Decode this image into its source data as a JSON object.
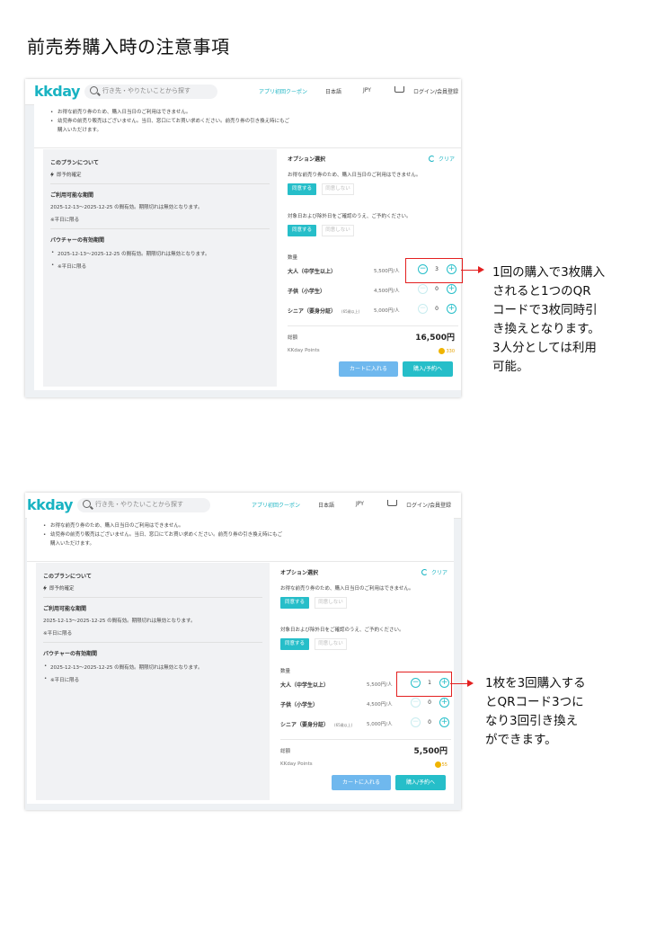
{
  "document": {
    "title": "前売券購入時の注意事項"
  },
  "site": {
    "logo": "kkday",
    "search_placeholder": "行き先・やりたいことから探す",
    "nav_coupon": "アプリ初回クーポン",
    "nav_language": "日本語",
    "nav_currency": "JPY",
    "nav_login": "ログイン/会員登録"
  },
  "notes": {
    "line1": "お得な前売り券のため、購入日当日のご利用はできません。",
    "line2": "幼児券の前売り販売はございません。当日、窓口にてお買い求めください。前売り券の引き換え時にもご",
    "line3": "購入いただけます。"
  },
  "plan": {
    "about_title": "このプランについて",
    "instant": "即予約確定",
    "validity_title": "ご利用可能な期間",
    "validity_text": "2025-12-13〜2025-12-25 の間有効。期限切れは無効となります。",
    "validity_note": "※平日に限る",
    "voucher_title": "バウチャーの有効期間",
    "voucher_bullet1": "2025-12-13〜2025-12-25 の間有効。期限切れは無効となります。",
    "voucher_bullet2": "※平日に限る"
  },
  "options": {
    "title": "オプション選択",
    "clear": "クリア",
    "q1": "お得な前売り券のため、購入日当日のご利用はできません。",
    "q2": "対象日および除外日をご確認のうえ、ご予約ください。",
    "agree": "同意する",
    "disagree": "同意しない",
    "quantity_title": "数量",
    "adult_label": "大人（中学生以上）",
    "child_label": "子供（小学生）",
    "senior_label": "シニア（要身分証）",
    "senior_sub": "(65歳以上)",
    "adult_price": "5,500円/人",
    "child_price": "4,500円/人",
    "senior_price": "5,000円/人",
    "total_label": "総額",
    "points_label": "KKday Points",
    "cart_button": "カートに入れる",
    "book_button": "購入/予約へ"
  },
  "screen1": {
    "adult_qty": "3",
    "child_qty": "0",
    "senior_qty": "0",
    "total": "16,500円",
    "points": "330"
  },
  "screen2": {
    "adult_qty": "1",
    "child_qty": "0",
    "senior_qty": "0",
    "total": "5,500円",
    "points": "55"
  },
  "callout1": {
    "lines": [
      "1回の購入で3枚購入",
      "されると1つのQR",
      "コードで3枚同時引",
      "き換えとなります。",
      "3人分としては利用",
      "可能。"
    ]
  },
  "callout2": {
    "lines": [
      "1枚を3回購入する",
      "とQRコード3つに",
      "なり3回引き換え",
      "ができます。"
    ]
  },
  "colors": {
    "accent": "#26bec9",
    "cart": "#6fb8ee",
    "callout": "#e32020"
  }
}
